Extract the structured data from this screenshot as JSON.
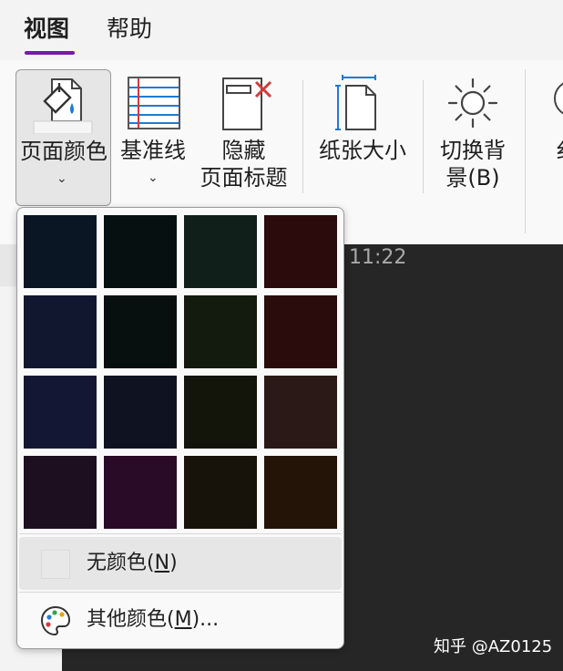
{
  "tabs": {
    "view": "视图",
    "help": "帮助"
  },
  "ribbon": {
    "page_color": "页面颜色",
    "rule_lines": "基准线",
    "hide_title_1": "隐藏",
    "hide_title_2": "页面标题",
    "paper_size": "纸张大小",
    "switch_bg_1": "切换背",
    "switch_bg_2": "景(B)",
    "chevron": "⌄",
    "partial": "纟"
  },
  "page": {
    "time": "11:22"
  },
  "dropdown": {
    "swatches": [
      "#0b1624",
      "#061011",
      "#111f1b",
      "#2b0b0c",
      "#121730",
      "#080f0f",
      "#131a0e",
      "#2a0c0d",
      "#141733",
      "#0f1220",
      "#13140a",
      "#2a1917",
      "#1d0f1f",
      "#2a0b27",
      "#18130a",
      "#241407"
    ],
    "no_color": {
      "pre": "无颜色(",
      "key": "N",
      "post": ")"
    },
    "more_colors": {
      "pre": "其他颜色(",
      "key": "M",
      "post": ")..."
    }
  },
  "watermark": "知乎 @AZ0125",
  "colors": {
    "accent": "#7719aa",
    "canvas": "#262626"
  }
}
